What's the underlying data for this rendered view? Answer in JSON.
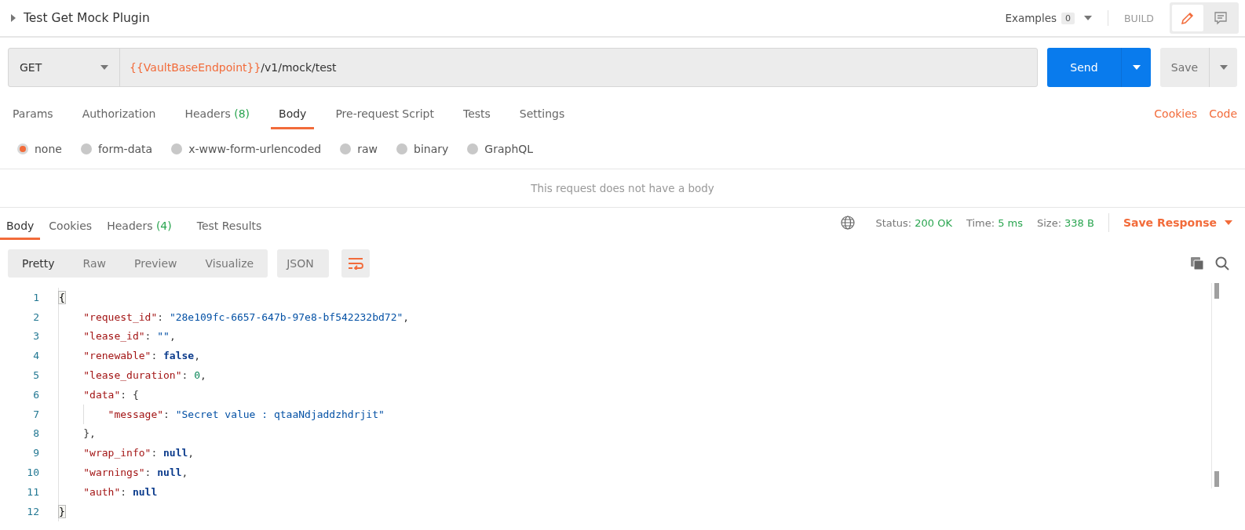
{
  "header": {
    "title": "Test Get Mock Plugin",
    "examples_label": "Examples",
    "examples_count": "0",
    "build_label": "BUILD",
    "modes": [
      {
        "kind": "edit",
        "selected": true
      },
      {
        "kind": "comment",
        "selected": false
      }
    ]
  },
  "request": {
    "method": "GET",
    "url_variable": "{{VaultBaseEndpoint}}",
    "url_path": "/v1/mock/test",
    "send_label": "Send",
    "save_label": "Save"
  },
  "request_tabs": [
    {
      "label": "Params",
      "selected": false
    },
    {
      "label": "Authorization",
      "selected": false
    },
    {
      "label": "Headers",
      "count": "(8)",
      "selected": false
    },
    {
      "label": "Body",
      "selected": true
    },
    {
      "label": "Pre-request Script",
      "selected": false
    },
    {
      "label": "Tests",
      "selected": false
    },
    {
      "label": "Settings",
      "selected": false
    }
  ],
  "request_links": [
    "Cookies",
    "Code"
  ],
  "body_types": [
    {
      "label": "none",
      "selected": true
    },
    {
      "label": "form-data",
      "selected": false
    },
    {
      "label": "x-www-form-urlencoded",
      "selected": false
    },
    {
      "label": "raw",
      "selected": false
    },
    {
      "label": "binary",
      "selected": false
    },
    {
      "label": "GraphQL",
      "selected": false
    }
  ],
  "body_message": "This request does not have a body",
  "response_tabs": [
    {
      "label": "Body",
      "selected": true
    },
    {
      "label": "Cookies",
      "selected": false
    },
    {
      "label": "Headers",
      "count": "(4)",
      "selected": false
    },
    {
      "label": "Test Results",
      "selected": false
    }
  ],
  "response_meta": [
    {
      "label": "Status:",
      "value": "200 OK"
    },
    {
      "label": "Time:",
      "value": "5 ms"
    },
    {
      "label": "Size:",
      "value": "338 B"
    }
  ],
  "save_response": "Save Response",
  "view_modes": [
    {
      "label": "Pretty",
      "selected": true
    },
    {
      "label": "Raw",
      "selected": false
    },
    {
      "label": "Preview",
      "selected": false
    },
    {
      "label": "Visualize",
      "selected": false
    }
  ],
  "format": "JSON",
  "code_lines": [
    {
      "number": "1",
      "tokens": [
        {
          "kind": "bracket-match",
          "text": "{"
        }
      ],
      "children": [
        {
          "number": "2",
          "tokens": [
            {
              "kind": "key",
              "text": "\"request_id\""
            },
            {
              "kind": "punct",
              "text": ": "
            },
            {
              "kind": "string",
              "text": "\"28e109fc-6657-647b-97e8-bf542232bd72\""
            },
            {
              "kind": "punct",
              "text": ","
            }
          ]
        },
        {
          "number": "3",
          "tokens": [
            {
              "kind": "key",
              "text": "\"lease_id\""
            },
            {
              "kind": "punct",
              "text": ": "
            },
            {
              "kind": "string",
              "text": "\"\""
            },
            {
              "kind": "punct",
              "text": ","
            }
          ]
        },
        {
          "number": "4",
          "tokens": [
            {
              "kind": "key",
              "text": "\"renewable\""
            },
            {
              "kind": "punct",
              "text": ": "
            },
            {
              "kind": "keyword",
              "text": "false"
            },
            {
              "kind": "punct",
              "text": ","
            }
          ]
        },
        {
          "number": "5",
          "tokens": [
            {
              "kind": "key",
              "text": "\"lease_duration\""
            },
            {
              "kind": "punct",
              "text": ": "
            },
            {
              "kind": "number",
              "text": "0"
            },
            {
              "kind": "punct",
              "text": ","
            }
          ]
        },
        {
          "number": "6",
          "tokens": [
            {
              "kind": "key",
              "text": "\"data\""
            },
            {
              "kind": "punct",
              "text": ": {"
            }
          ],
          "children": [
            {
              "number": "7",
              "tokens": [
                {
                  "kind": "key",
                  "text": "\"message\""
                },
                {
                  "kind": "punct",
                  "text": ": "
                },
                {
                  "kind": "string",
                  "text": "\"Secret value : qtaaNdjaddzhdrjit\""
                }
              ]
            }
          ]
        },
        {
          "number": "8",
          "tokens": [
            {
              "kind": "punct",
              "text": "},"
            }
          ]
        },
        {
          "number": "9",
          "tokens": [
            {
              "kind": "key",
              "text": "\"wrap_info\""
            },
            {
              "kind": "punct",
              "text": ": "
            },
            {
              "kind": "keyword",
              "text": "null"
            },
            {
              "kind": "punct",
              "text": ","
            }
          ]
        },
        {
          "number": "10",
          "tokens": [
            {
              "kind": "key",
              "text": "\"warnings\""
            },
            {
              "kind": "punct",
              "text": ": "
            },
            {
              "kind": "keyword",
              "text": "null"
            },
            {
              "kind": "punct",
              "text": ","
            }
          ]
        },
        {
          "number": "11",
          "tokens": [
            {
              "kind": "key",
              "text": "\"auth\""
            },
            {
              "kind": "punct",
              "text": ": "
            },
            {
              "kind": "keyword",
              "text": "null"
            }
          ]
        }
      ]
    },
    {
      "number": "12",
      "tokens": [
        {
          "kind": "bracket-match",
          "text": "}"
        }
      ]
    }
  ]
}
